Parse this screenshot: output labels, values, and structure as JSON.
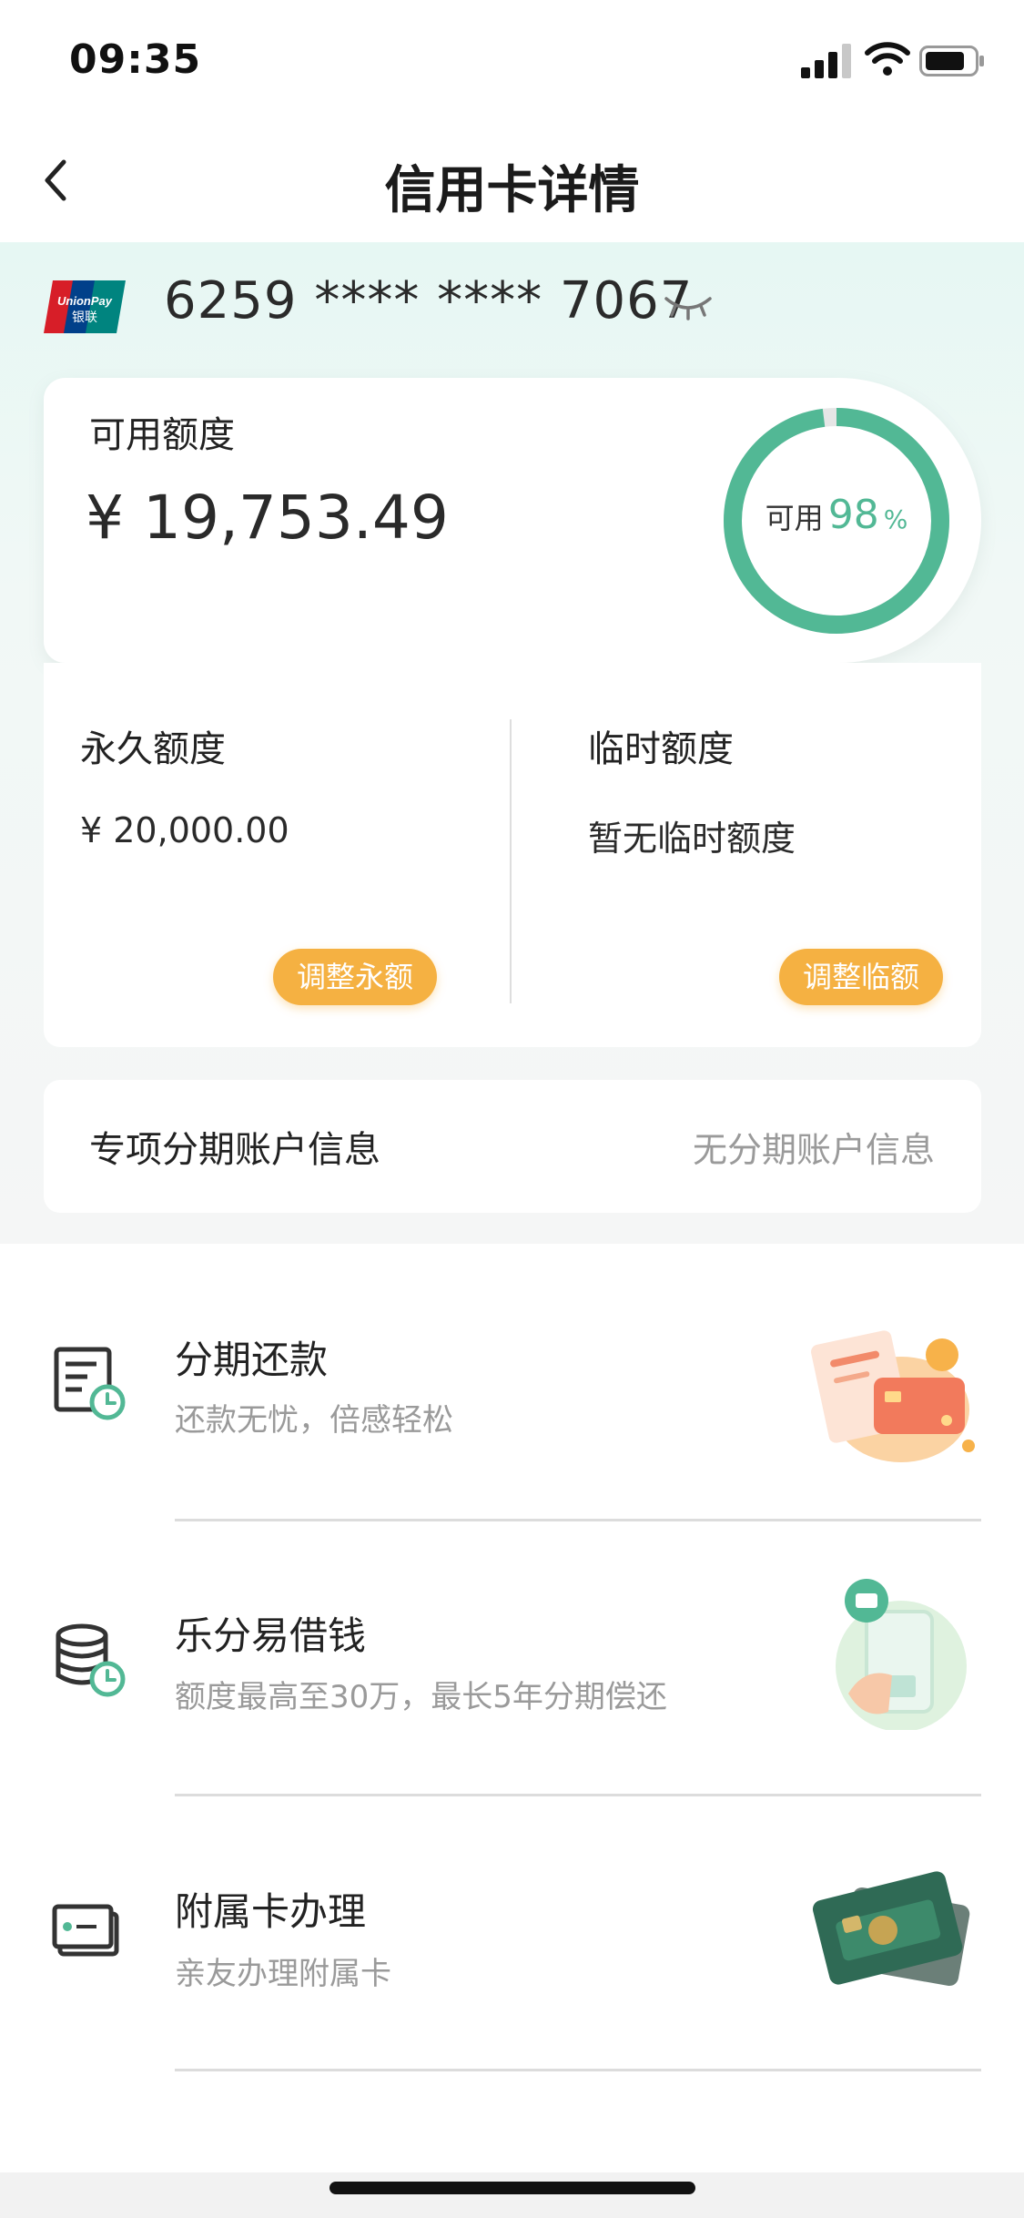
{
  "status_bar": {
    "time": "09:35"
  },
  "nav": {
    "title": "信用卡详情"
  },
  "card": {
    "number": "6259 **** **** 7067",
    "logo_text": "UnionPay 银联"
  },
  "available": {
    "label": "可用额度",
    "amount": "¥ 19,753.49",
    "ring_label": "可用",
    "ring_percent": "98",
    "ring_unit": "%",
    "ring_fraction": 0.98
  },
  "permanent": {
    "label": "永久额度",
    "value": "¥ 20,000.00",
    "button": "调整永额"
  },
  "temporary": {
    "label": "临时额度",
    "value": "暂无临时额度",
    "button": "调整临额"
  },
  "installment_account": {
    "label": "专项分期账户信息",
    "value": "无分期账户信息"
  },
  "services": [
    {
      "title": "分期还款",
      "subtitle": "还款无忧，倍感轻松",
      "icon": "bill-clock-icon"
    },
    {
      "title": "乐分易借钱",
      "subtitle": "额度最高至30万，最长5年分期偿还",
      "icon": "coins-clock-icon"
    },
    {
      "title": "附属卡办理",
      "subtitle": "亲友办理附属卡",
      "icon": "card-icon"
    }
  ],
  "colors": {
    "accent_green": "#52b895",
    "button_orange": "#f5b142"
  }
}
